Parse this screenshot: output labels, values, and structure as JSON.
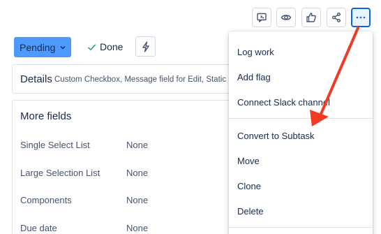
{
  "toolbar": {
    "icons": [
      "feedback-icon",
      "watch-eye-icon",
      "thumbs-up-icon",
      "share-icon",
      "more-actions-icon"
    ]
  },
  "status": {
    "label": "Pending",
    "done_label": "Done"
  },
  "details": {
    "title": "Details",
    "subtitle": "Custom Checkbox, Message field for Edit, Static M"
  },
  "more_fields": {
    "title": "More fields",
    "fields": [
      {
        "label": "Single Select List",
        "value": "None"
      },
      {
        "label": "Large Selection List",
        "value": "None"
      },
      {
        "label": "Components",
        "value": "None"
      },
      {
        "label": "Due date",
        "value": "None"
      }
    ]
  },
  "menu": {
    "items": [
      "Log work",
      "Add flag",
      "Connect Slack channel",
      "Convert to Subtask",
      "Move",
      "Clone",
      "Delete"
    ]
  },
  "colors": {
    "accent": "#4c9aff",
    "annotation_arrow": "#f03a24"
  }
}
